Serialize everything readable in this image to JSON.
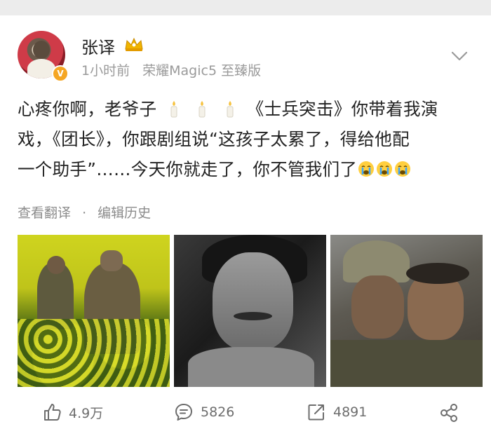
{
  "post": {
    "username": "张译",
    "time": "1小时前",
    "device": "荣耀Magic5 至臻版",
    "verified_mark": "V",
    "text_line1_a": "心疼你啊，老爷子",
    "text_line1_b": "《士兵突击》你带着我演",
    "text_line2": "戏，《团长》，你跟剧组说“这孩子太累了，得给他配",
    "text_line3": "一个助手”……今天你就走了，你不管我们了",
    "candle_count": 3,
    "cry_count": 3,
    "translate_label": "查看翻译",
    "separator": "·",
    "edit_history_label": "编辑历史"
  },
  "images": [
    {
      "name": "field-scene"
    },
    {
      "name": "portrait-bw"
    },
    {
      "name": "embrace-scene"
    }
  ],
  "actions": {
    "like_count": "4.9万",
    "comment_count": "5826",
    "repost_count": "4891"
  },
  "icons": [
    "crown-icon",
    "chevron-down-icon",
    "candle-icon",
    "crying-face-icon",
    "like-icon",
    "comment-icon",
    "repost-icon",
    "share-icon"
  ],
  "colors": {
    "verified": "#f5a623",
    "crown": "#f0b400",
    "meta_text": "#9a9a9a"
  }
}
